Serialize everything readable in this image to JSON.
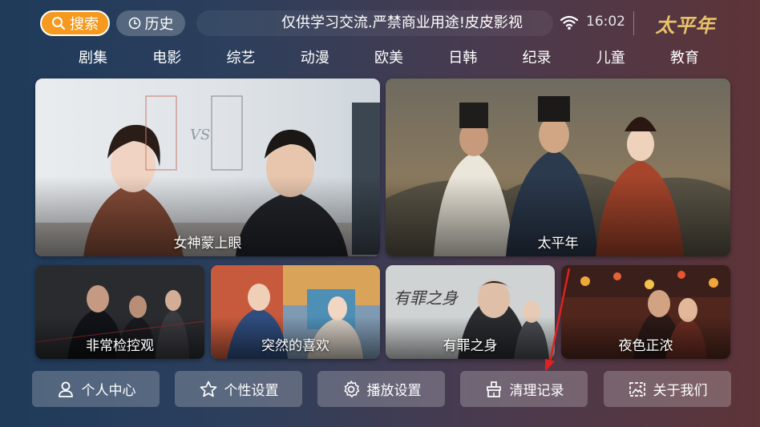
{
  "header": {
    "search_label": "搜索",
    "history_label": "历史",
    "notice": "仅供学习交流.严禁商业用途!皮皮影视",
    "time": "16:02",
    "logo_text": "太平年"
  },
  "categories": [
    "剧集",
    "电影",
    "综艺",
    "动漫",
    "欧美",
    "日韩",
    "纪录",
    "儿童",
    "教育"
  ],
  "featured": [
    {
      "title": "女神蒙上眼"
    },
    {
      "title": "太平年"
    }
  ],
  "posters": [
    {
      "title": "非常检控观"
    },
    {
      "title": "突然的喜欢"
    },
    {
      "title": "有罪之身"
    },
    {
      "title": "夜色正浓"
    }
  ],
  "bottom_buttons": [
    {
      "label": "个人中心",
      "icon": "person-icon"
    },
    {
      "label": "个性设置",
      "icon": "star-icon"
    },
    {
      "label": "播放设置",
      "icon": "gear-icon"
    },
    {
      "label": "清理记录",
      "icon": "broom-icon"
    },
    {
      "label": "关于我们",
      "icon": "info-image-icon"
    }
  ],
  "colors": {
    "accent": "#f59a1e",
    "annotation": "#e0221f"
  }
}
